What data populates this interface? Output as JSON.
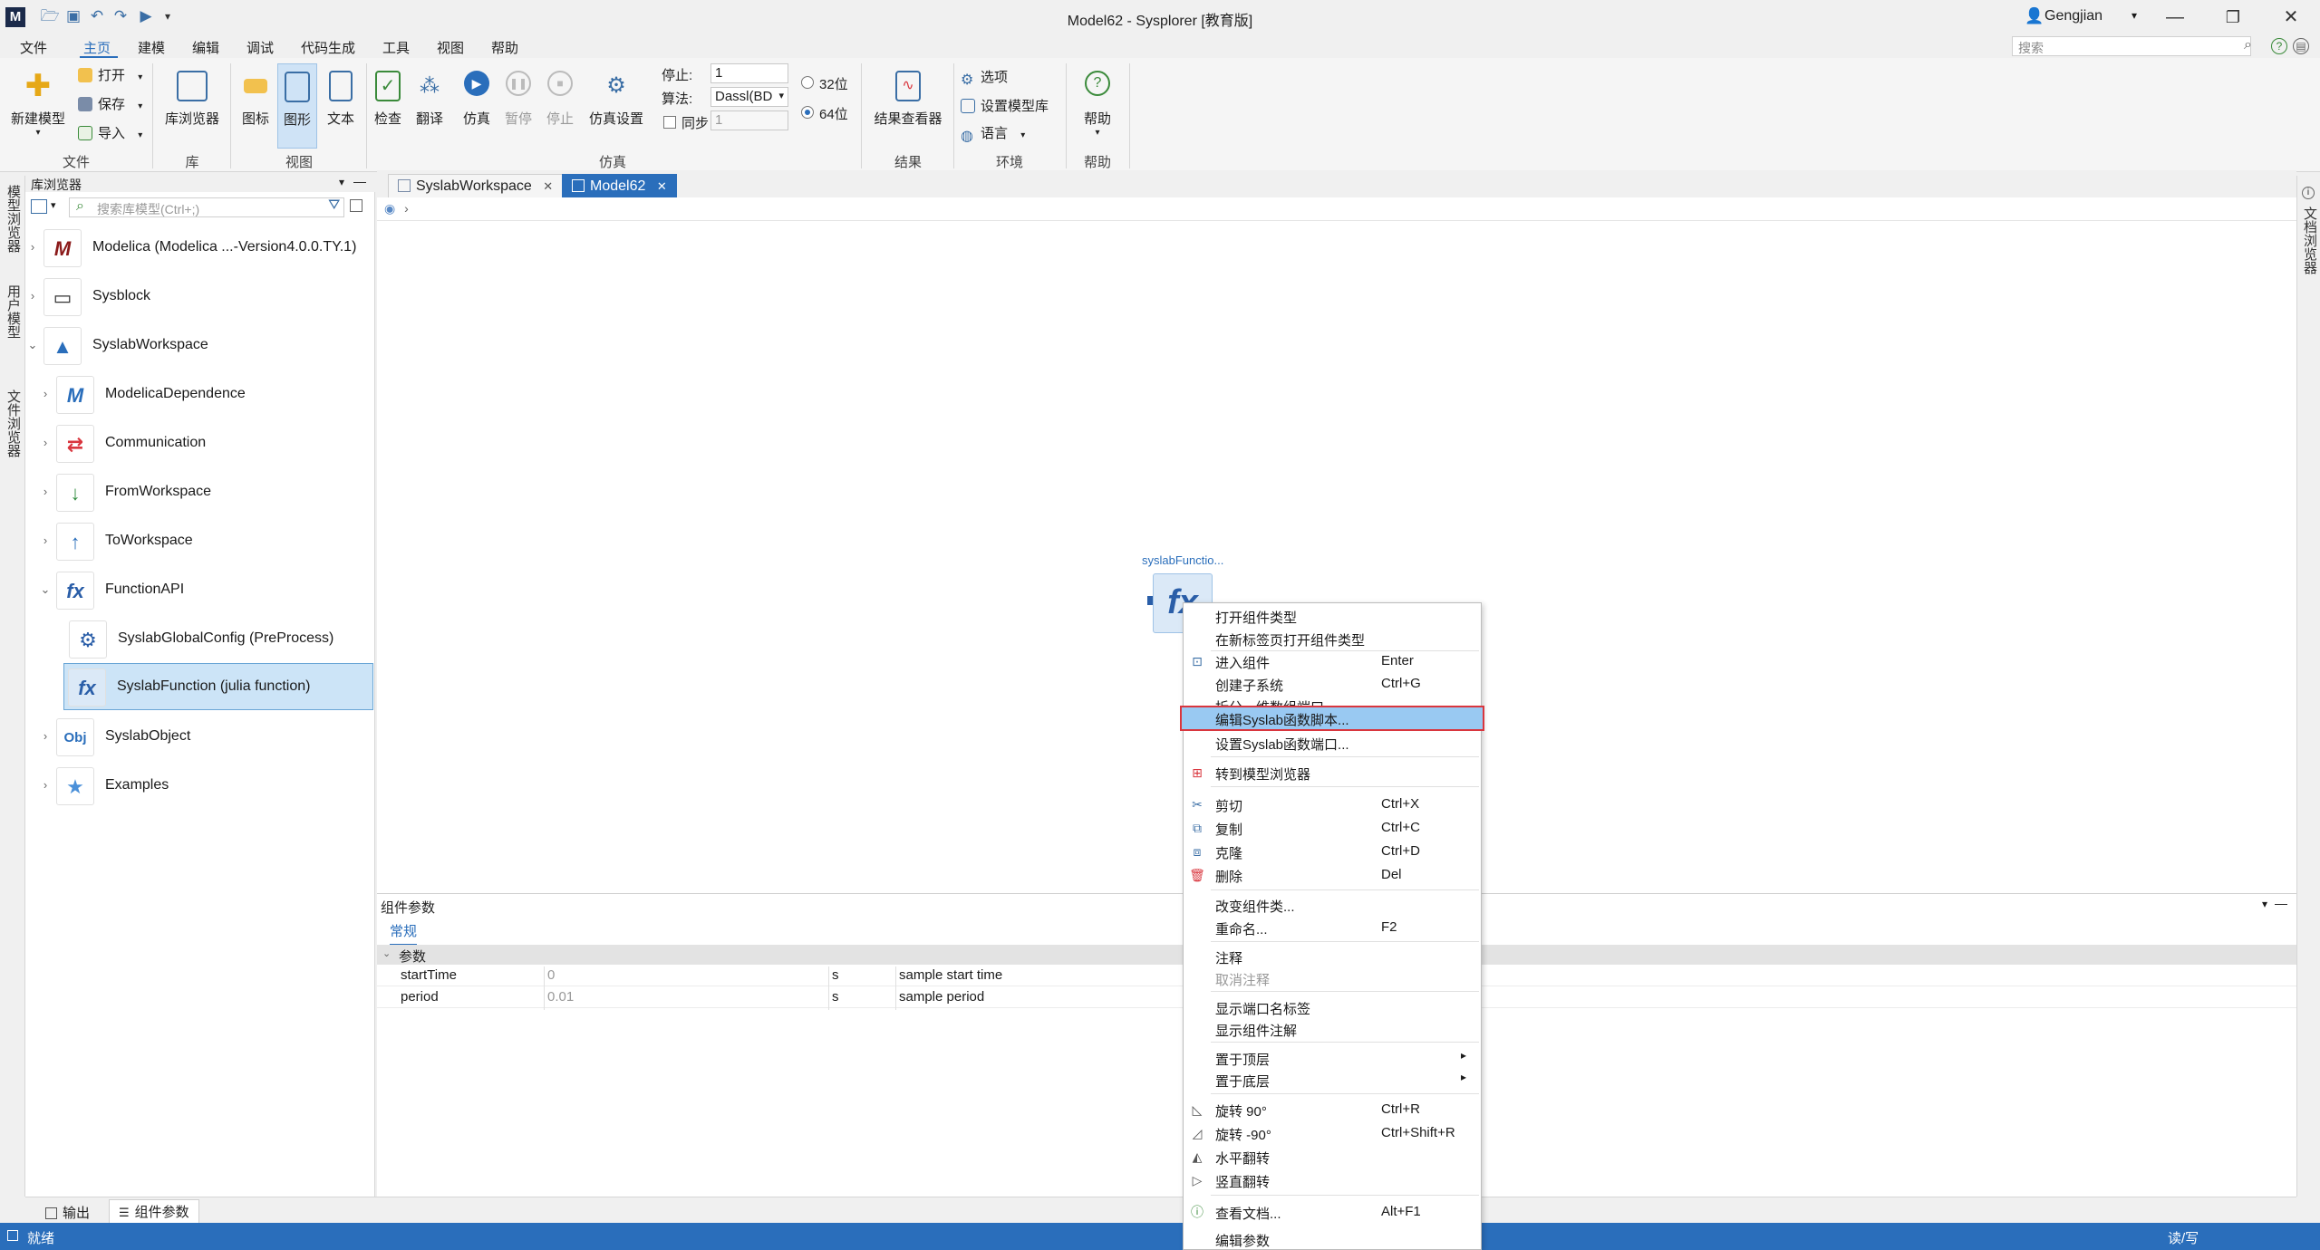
{
  "window": {
    "title": "Model62 - Sysplorer [教育版]",
    "user": "Gengjian",
    "app_icon_letter": "M"
  },
  "menu": {
    "items": [
      "文件",
      "主页",
      "建模",
      "编辑",
      "调试",
      "代码生成",
      "工具",
      "视图",
      "帮助"
    ],
    "active_index": 1,
    "search_placeholder": "搜索"
  },
  "ribbon": {
    "file": {
      "new_model": "新建模型",
      "open": "打开",
      "save": "保存",
      "import": "导入",
      "group": "文件"
    },
    "lib": {
      "browser": "库浏览器",
      "group": "库"
    },
    "view": {
      "icon": "图标",
      "graphic": "图形",
      "text": "文本",
      "group": "视图"
    },
    "sim": {
      "check": "检查",
      "translate": "翻译",
      "simulate": "仿真",
      "pause": "暂停",
      "stop": "停止",
      "settings": "仿真设置",
      "stop_label": "停止:",
      "stop_value": "1",
      "algo_label": "算法:",
      "algo_value": "Dassl(BD",
      "sync_label": "同步",
      "sync_value": "1",
      "bit32": "32位",
      "bit64": "64位",
      "group": "仿真"
    },
    "result": {
      "viewer": "结果查看器",
      "group": "结果"
    },
    "env": {
      "options": "选项",
      "model_lib": "设置模型库",
      "language": "语言",
      "group": "环境"
    },
    "help": {
      "help": "帮助",
      "group": "帮助"
    }
  },
  "side_tabs": {
    "left": [
      "模型浏览器",
      "用户模型",
      "文件浏览器"
    ],
    "right": "文档浏览器"
  },
  "library": {
    "header": "库浏览器",
    "search_placeholder": "搜索库模型(Ctrl+;)",
    "items": [
      {
        "label": "Modelica (Modelica ...-Version4.0.0.TY.1)",
        "icon": "M",
        "color": "#8b1a1a"
      },
      {
        "label": "Sysblock",
        "icon": "▭",
        "color": "#333333"
      },
      {
        "label": "SyslabWorkspace",
        "icon": "▲",
        "color": "#2a6ebb"
      },
      {
        "label": "ModelicaDependence",
        "icon": "M",
        "color": "#2a6ebb"
      },
      {
        "label": "Communication",
        "icon": "⇄",
        "color": "#d9363e"
      },
      {
        "label": "FromWorkspace",
        "icon": "↓",
        "color": "#2e8b3d"
      },
      {
        "label": "ToWorkspace",
        "icon": "↑",
        "color": "#2a6ebb"
      },
      {
        "label": "FunctionAPI",
        "icon": "fx",
        "color": "#2a5ea8"
      },
      {
        "label": "SyslabGlobalConfig (PreProcess)",
        "icon": "⚙",
        "color": "#2a5ea8"
      },
      {
        "label": "SyslabFunction (julia function)",
        "icon": "fx",
        "color": "#2a5ea8"
      },
      {
        "label": "SyslabObject",
        "icon": "Obj",
        "color": "#2a6ebb"
      },
      {
        "label": "Examples",
        "icon": "★",
        "color": "#4a90d9"
      }
    ]
  },
  "editor": {
    "tabs": [
      "SyslabWorkspace",
      "Model62"
    ],
    "active_tab": 1,
    "component_name": "syslabFunctio...",
    "component_icon": "fx"
  },
  "params": {
    "header": "组件参数",
    "tab": "常规",
    "group": "参数",
    "rows": [
      {
        "name": "startTime",
        "value": "0",
        "unit": "s",
        "desc": "sample start time"
      },
      {
        "name": "period",
        "value": "0.01",
        "unit": "s",
        "desc": "sample period"
      }
    ]
  },
  "bottom_tabs": [
    "输出",
    "组件参数"
  ],
  "status": {
    "left": "就绪",
    "right": "读/写"
  },
  "context_menu": {
    "items": [
      {
        "label": "打开组件类型",
        "shortcut": ""
      },
      {
        "label": "在新标签页打开组件类型",
        "shortcut": ""
      },
      {
        "label": "进入组件",
        "shortcut": "Enter"
      },
      {
        "label": "创建子系统",
        "shortcut": "Ctrl+G"
      },
      {
        "label": "拆分一维数组端口",
        "shortcut": ""
      },
      {
        "label": "编辑Syslab函数脚本...",
        "shortcut": ""
      },
      {
        "label": "设置Syslab函数端口...",
        "shortcut": ""
      },
      {
        "label": "转到模型浏览器",
        "shortcut": ""
      },
      {
        "label": "剪切",
        "shortcut": "Ctrl+X"
      },
      {
        "label": "复制",
        "shortcut": "Ctrl+C"
      },
      {
        "label": "克隆",
        "shortcut": "Ctrl+D"
      },
      {
        "label": "删除",
        "shortcut": "Del"
      },
      {
        "label": "改变组件类...",
        "shortcut": ""
      },
      {
        "label": "重命名...",
        "shortcut": "F2"
      },
      {
        "label": "注释",
        "shortcut": ""
      },
      {
        "label": "取消注释",
        "shortcut": ""
      },
      {
        "label": "显示端口名标签",
        "shortcut": ""
      },
      {
        "label": "显示组件注解",
        "shortcut": ""
      },
      {
        "label": "置于顶层",
        "shortcut": ""
      },
      {
        "label": "置于底层",
        "shortcut": ""
      },
      {
        "label": "旋转 90°",
        "shortcut": "Ctrl+R"
      },
      {
        "label": "旋转 -90°",
        "shortcut": "Ctrl+Shift+R"
      },
      {
        "label": "水平翻转",
        "shortcut": ""
      },
      {
        "label": "竖直翻转",
        "shortcut": ""
      },
      {
        "label": "查看文档...",
        "shortcut": "Alt+F1"
      },
      {
        "label": "编辑参数",
        "shortcut": ""
      }
    ],
    "highlighted_index": 5
  },
  "colors": {
    "accent": "#2a6ebb",
    "highlight_border": "#d9363e",
    "menu_highlight": "#99c9f2"
  }
}
